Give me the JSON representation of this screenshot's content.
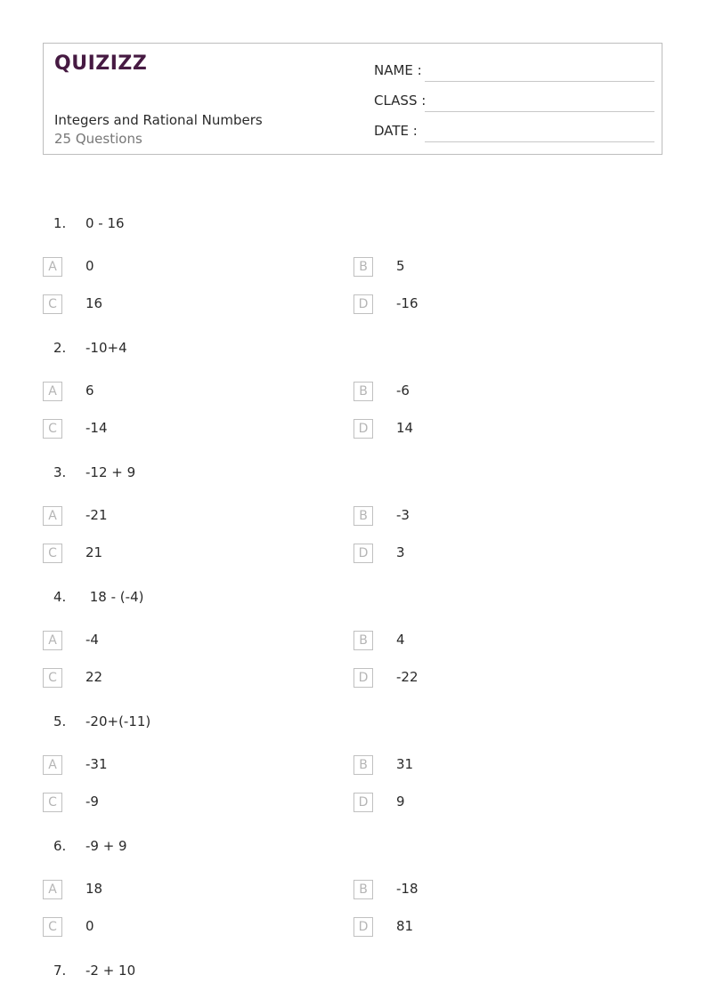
{
  "header": {
    "logo": "QUIZIZZ",
    "title": "Integers and Rational Numbers",
    "subtitle": "25 Questions",
    "fields": [
      {
        "label": "NAME :"
      },
      {
        "label": "CLASS :"
      },
      {
        "label": "DATE  :"
      }
    ]
  },
  "questions": [
    {
      "num": "1.",
      "text": "0 - 16",
      "options": [
        {
          "letter": "A",
          "text": "0"
        },
        {
          "letter": "B",
          "text": "5"
        },
        {
          "letter": "C",
          "text": "16"
        },
        {
          "letter": "D",
          "text": "-16"
        }
      ]
    },
    {
      "num": "2.",
      "text": "-10+4",
      "options": [
        {
          "letter": "A",
          "text": "6"
        },
        {
          "letter": "B",
          "text": "-6"
        },
        {
          "letter": "C",
          "text": "-14"
        },
        {
          "letter": "D",
          "text": "14"
        }
      ]
    },
    {
      "num": "3.",
      "text": "-12 + 9",
      "options": [
        {
          "letter": "A",
          "text": "-21"
        },
        {
          "letter": "B",
          "text": "-3"
        },
        {
          "letter": "C",
          "text": "21"
        },
        {
          "letter": "D",
          "text": "3"
        }
      ]
    },
    {
      "num": "4.",
      "text": " 18 - (-4)",
      "options": [
        {
          "letter": "A",
          "text": "-4"
        },
        {
          "letter": "B",
          "text": "4"
        },
        {
          "letter": "C",
          "text": "22"
        },
        {
          "letter": "D",
          "text": "-22"
        }
      ]
    },
    {
      "num": "5.",
      "text": "-20+(-11)",
      "options": [
        {
          "letter": "A",
          "text": "-31"
        },
        {
          "letter": "B",
          "text": "31"
        },
        {
          "letter": "C",
          "text": "-9"
        },
        {
          "letter": "D",
          "text": "9"
        }
      ]
    },
    {
      "num": "6.",
      "text": "-9 + 9",
      "options": [
        {
          "letter": "A",
          "text": "18"
        },
        {
          "letter": "B",
          "text": "-18"
        },
        {
          "letter": "C",
          "text": "0"
        },
        {
          "letter": "D",
          "text": "81"
        }
      ]
    },
    {
      "num": "7.",
      "text": "-2 + 10",
      "options": []
    }
  ]
}
